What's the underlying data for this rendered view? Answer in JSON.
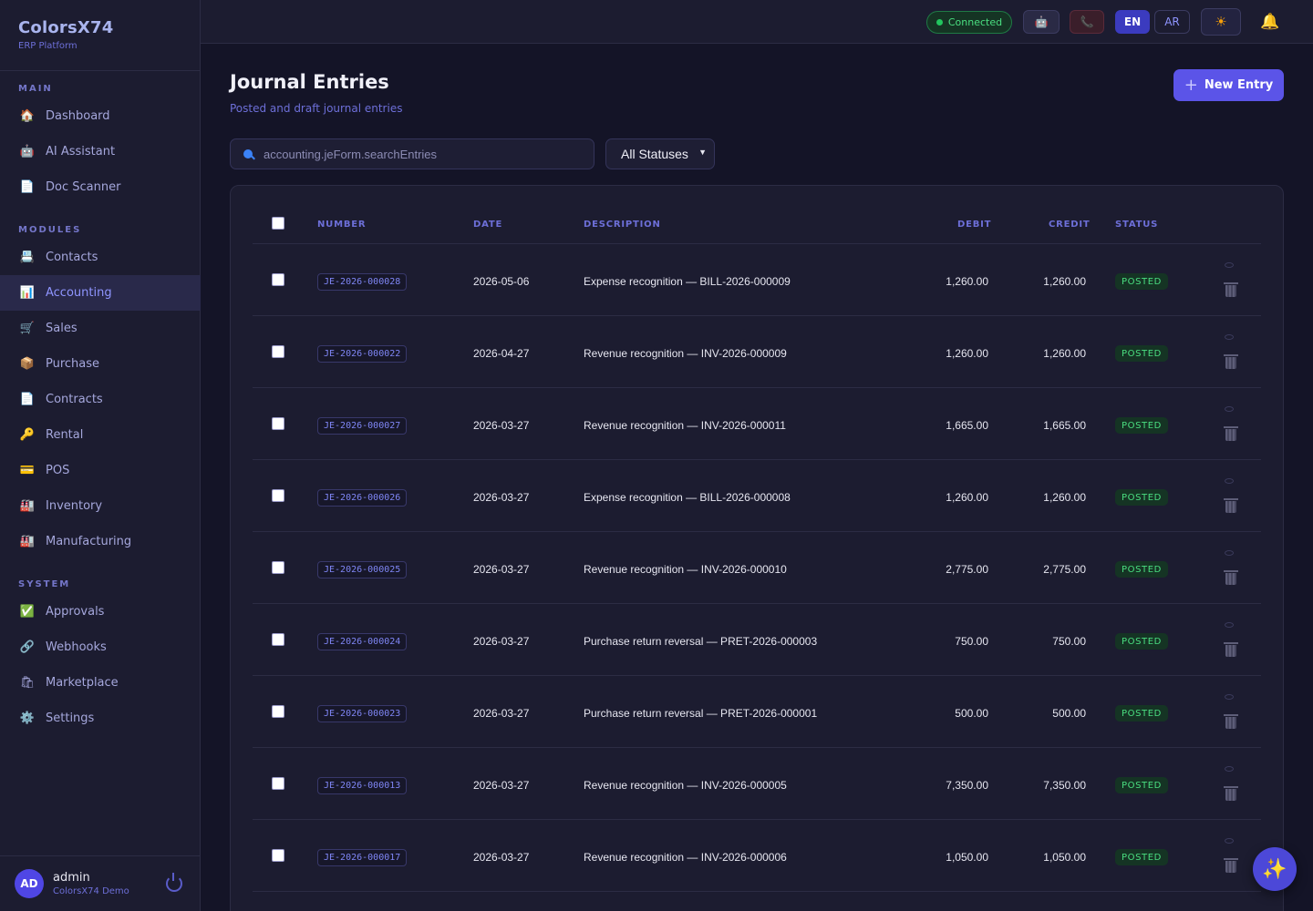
{
  "app": {
    "name": "ColorsX74",
    "subtitle": "ERP Platform"
  },
  "sidebar": {
    "sections": [
      {
        "title": "MAIN",
        "items": [
          {
            "label": "Dashboard",
            "icon": "house-icon"
          },
          {
            "label": "AI Assistant",
            "icon": "robot-icon"
          },
          {
            "label": "Doc Scanner",
            "icon": "document-icon"
          }
        ]
      },
      {
        "title": "MODULES",
        "items": [
          {
            "label": "Contacts",
            "icon": "contacts-icon"
          },
          {
            "label": "Accounting",
            "icon": "bar-chart-icon",
            "active": true
          },
          {
            "label": "Sales",
            "icon": "cash-register-icon"
          },
          {
            "label": "Purchase",
            "icon": "package-icon"
          },
          {
            "label": "Contracts",
            "icon": "document-icon"
          },
          {
            "label": "Rental",
            "icon": "key-icon"
          },
          {
            "label": "POS",
            "icon": "credit-card-icon"
          },
          {
            "label": "Inventory",
            "icon": "factory-icon"
          },
          {
            "label": "Manufacturing",
            "icon": "factory-icon"
          }
        ]
      },
      {
        "title": "SYSTEM",
        "items": [
          {
            "label": "Approvals",
            "icon": "check-icon"
          },
          {
            "label": "Webhooks",
            "icon": "link-icon"
          },
          {
            "label": "Marketplace",
            "icon": "shopping-bags-icon"
          },
          {
            "label": "Settings",
            "icon": "gear-icon"
          }
        ]
      }
    ],
    "user": {
      "initials": "AD",
      "name": "admin",
      "org": "ColorsX74 Demo"
    }
  },
  "topbar": {
    "connection_status": "Connected",
    "lang_en": "EN",
    "lang_ar": "AR"
  },
  "page": {
    "title": "Journal Entries",
    "subtitle": "Posted and draft journal entries",
    "new_button": "New Entry",
    "search_placeholder": "accounting.jeForm.searchEntries",
    "status_filter": "All Statuses"
  },
  "table": {
    "columns": {
      "number": "NUMBER",
      "date": "DATE",
      "description": "DESCRIPTION",
      "debit": "DEBIT",
      "credit": "CREDIT",
      "status": "STATUS"
    },
    "rows": [
      {
        "number": "JE-2026-000028",
        "date": "2026-05-06",
        "description": "Expense recognition — BILL-2026-000009",
        "debit": "1,260.00",
        "credit": "1,260.00",
        "status": "POSTED"
      },
      {
        "number": "JE-2026-000022",
        "date": "2026-04-27",
        "description": "Revenue recognition — INV-2026-000009",
        "debit": "1,260.00",
        "credit": "1,260.00",
        "status": "POSTED"
      },
      {
        "number": "JE-2026-000027",
        "date": "2026-03-27",
        "description": "Revenue recognition — INV-2026-000011",
        "debit": "1,665.00",
        "credit": "1,665.00",
        "status": "POSTED"
      },
      {
        "number": "JE-2026-000026",
        "date": "2026-03-27",
        "description": "Expense recognition — BILL-2026-000008",
        "debit": "1,260.00",
        "credit": "1,260.00",
        "status": "POSTED"
      },
      {
        "number": "JE-2026-000025",
        "date": "2026-03-27",
        "description": "Revenue recognition — INV-2026-000010",
        "debit": "2,775.00",
        "credit": "2,775.00",
        "status": "POSTED"
      },
      {
        "number": "JE-2026-000024",
        "date": "2026-03-27",
        "description": "Purchase return reversal — PRET-2026-000003",
        "debit": "750.00",
        "credit": "750.00",
        "status": "POSTED"
      },
      {
        "number": "JE-2026-000023",
        "date": "2026-03-27",
        "description": "Purchase return reversal — PRET-2026-000001",
        "debit": "500.00",
        "credit": "500.00",
        "status": "POSTED"
      },
      {
        "number": "JE-2026-000013",
        "date": "2026-03-27",
        "description": "Revenue recognition — INV-2026-000005",
        "debit": "7,350.00",
        "credit": "7,350.00",
        "status": "POSTED"
      },
      {
        "number": "JE-2026-000017",
        "date": "2026-03-27",
        "description": "Revenue recognition — INV-2026-000006",
        "debit": "1,050.00",
        "credit": "1,050.00",
        "status": "POSTED"
      }
    ]
  },
  "colors": {
    "accent": "#5b54e8",
    "posted": "#4ade80",
    "background": "#141427",
    "sidebar": "#1c1c30"
  }
}
